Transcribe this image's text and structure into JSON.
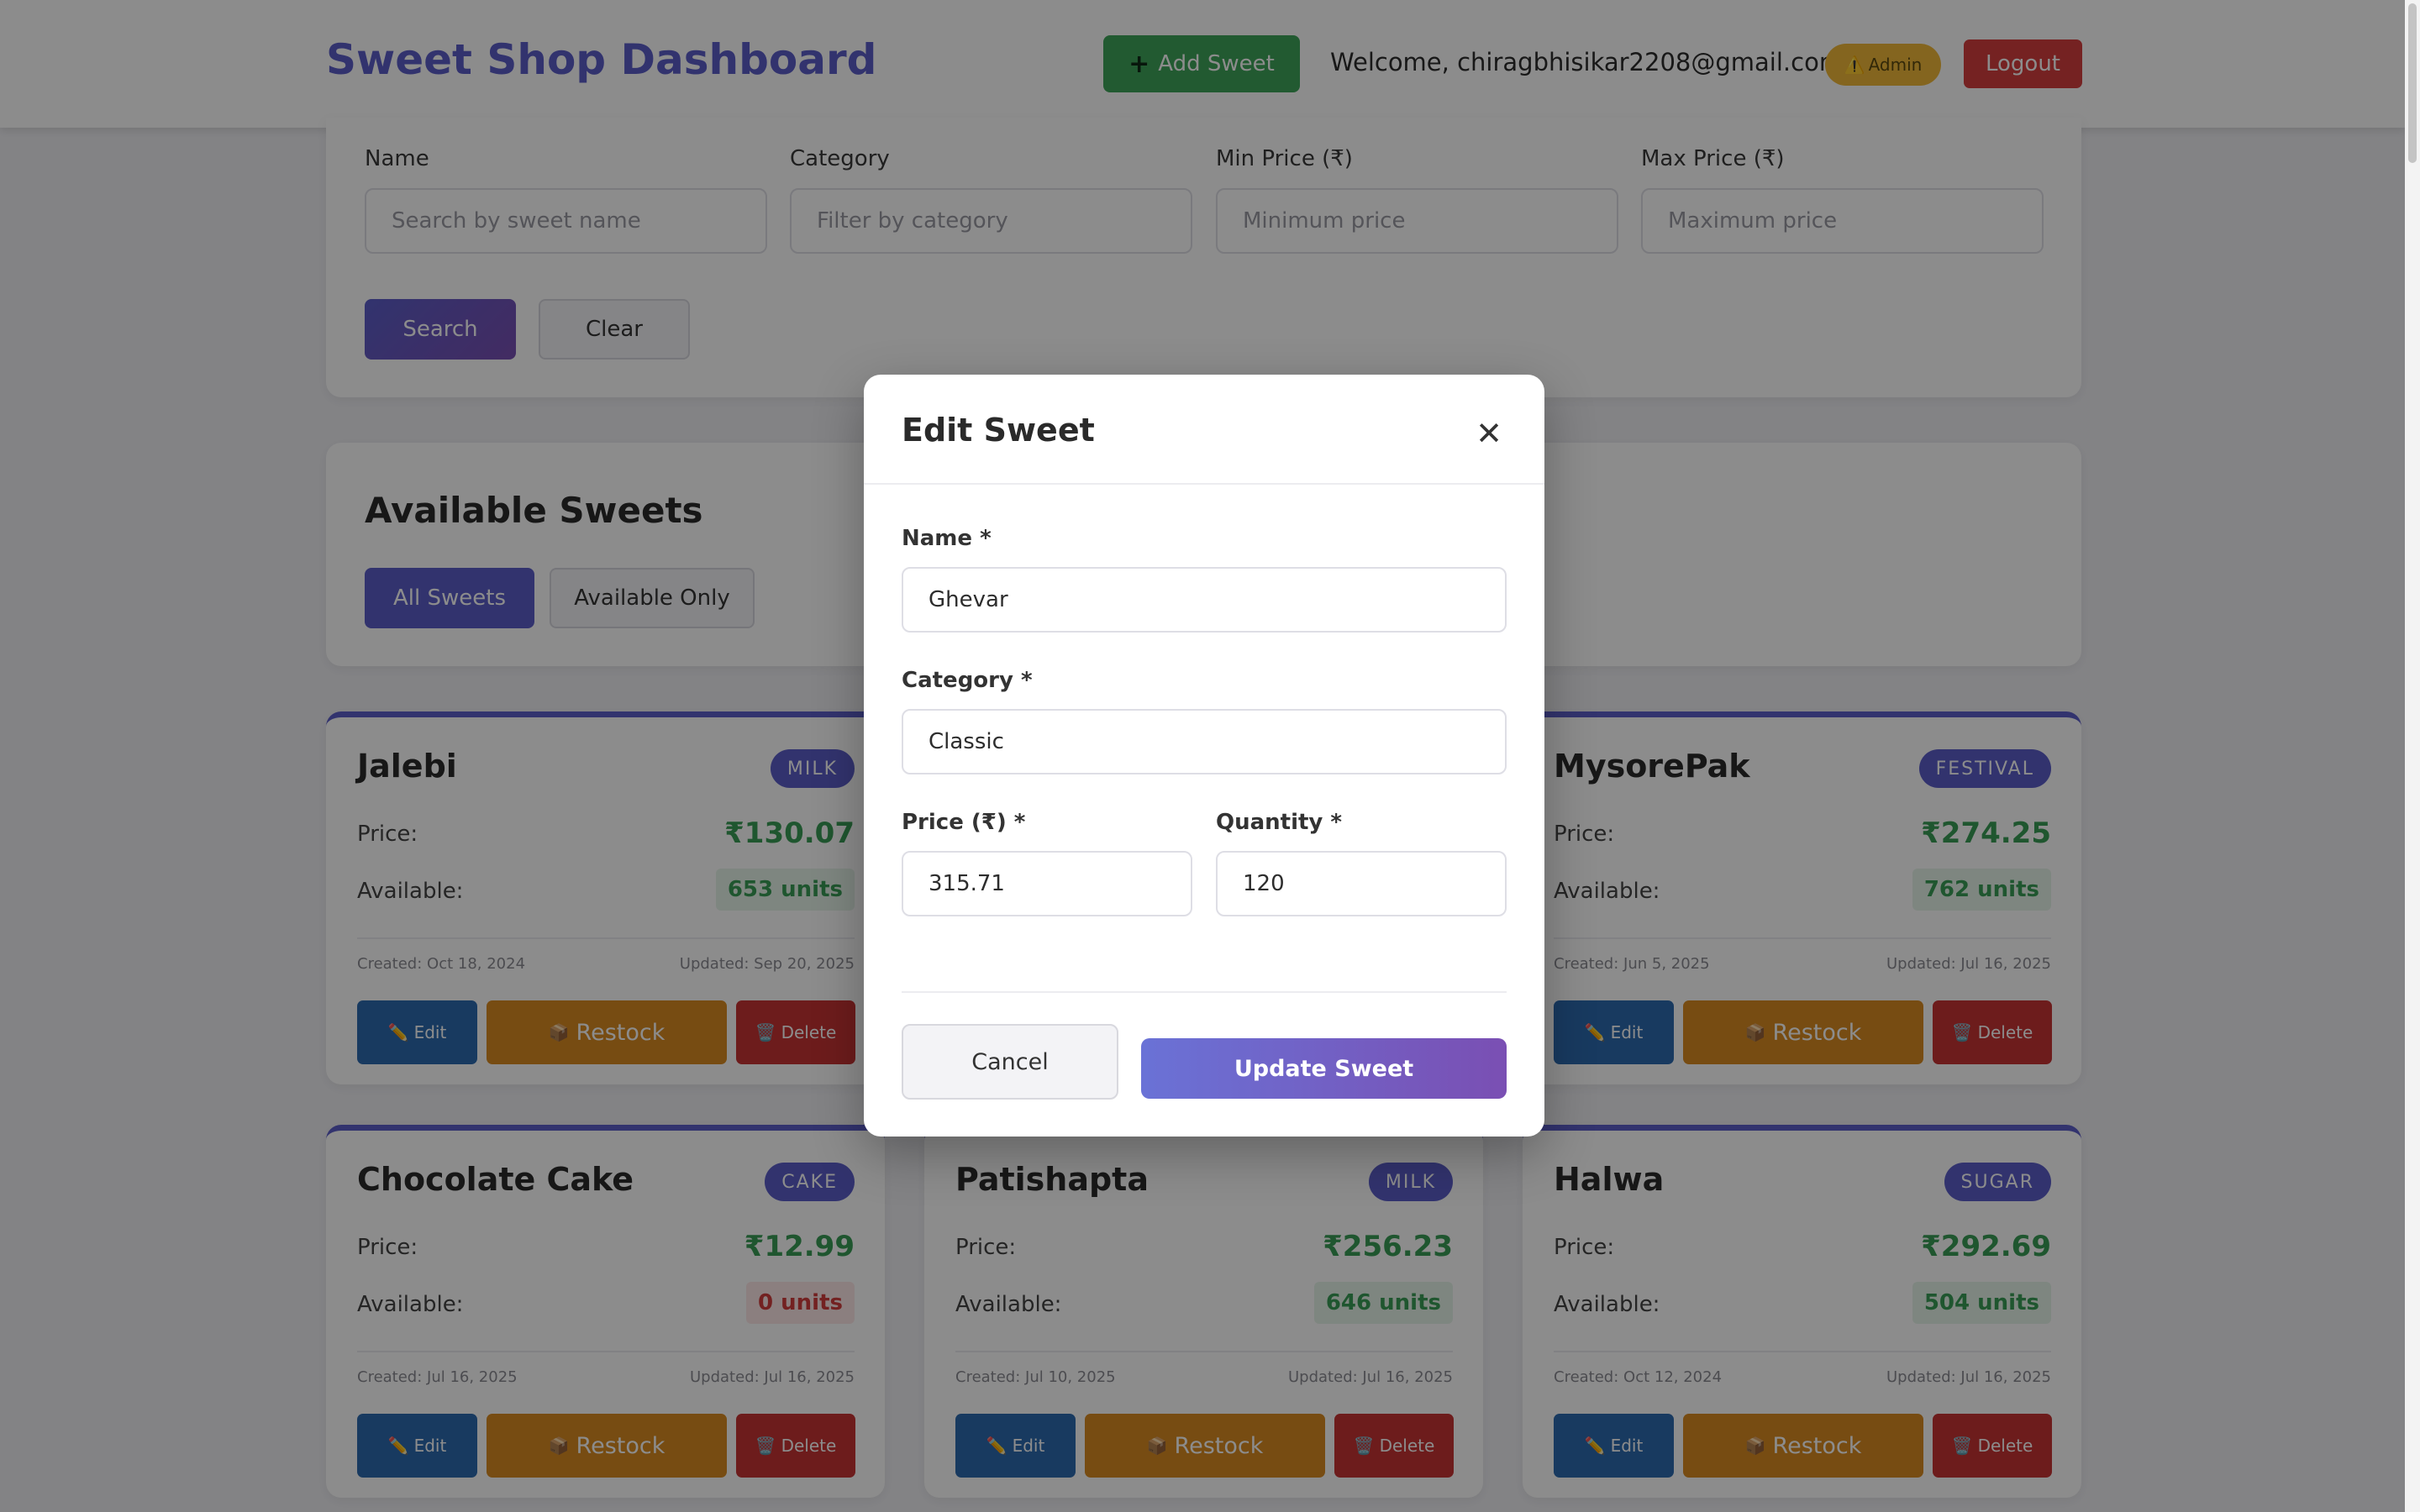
{
  "header": {
    "brand": "Sweet Shop Dashboard",
    "add_button": "Add Sweet",
    "add_icon": "+",
    "welcome": "Welcome, chiragbhisikar2208@gmail.com",
    "admin_badge": "Admin",
    "admin_icon": "⚠️",
    "logout": "Logout"
  },
  "filters": {
    "name_label": "Name",
    "name_placeholder": "Search by sweet name",
    "category_label": "Category",
    "category_placeholder": "Filter by category",
    "min_label": "Min Price (₹)",
    "min_placeholder": "Minimum price",
    "max_label": "Max Price (₹)",
    "max_placeholder": "Maximum price",
    "search_button": "Search",
    "clear_button": "Clear"
  },
  "sweets_section": {
    "title": "Available Sweets",
    "tab_all": "All Sweets",
    "tab_available": "Available Only"
  },
  "card_labels": {
    "price": "Price:",
    "available": "Available:",
    "edit": "Edit",
    "edit_icon": "✏️",
    "restock": "Restock",
    "restock_icon": "📦",
    "delete": "Delete",
    "delete_icon": "🗑️"
  },
  "cards": [
    {
      "name": "Jalebi",
      "category": "MILK",
      "price": "₹130.07",
      "units": "653 units",
      "created": "Created: Oct 18, 2024",
      "updated": "Updated: Sep 20, 2025"
    },
    {
      "name": "MysorePak",
      "category": "FESTIVAL",
      "price": "₹274.25",
      "units": "762 units",
      "created": "Created: Jun 5, 2025",
      "updated": "Updated: Jul 16, 2025"
    },
    {
      "name": "Chocolate Cake",
      "category": "CAKE",
      "price": "₹12.99",
      "units": "0 units",
      "created": "Created: Jul 16, 2025",
      "updated": "Updated: Jul 16, 2025"
    },
    {
      "name": "Patishapta",
      "category": "MILK",
      "price": "₹256.23",
      "units": "646 units",
      "created": "Created: Jul 10, 2025",
      "updated": "Updated: Jul 16, 2025"
    },
    {
      "name": "Halwa",
      "category": "SUGAR",
      "price": "₹292.69",
      "units": "504 units",
      "created": "Created: Oct 12, 2024",
      "updated": "Updated: Jul 16, 2025"
    }
  ],
  "modal": {
    "title": "Edit Sweet",
    "close_icon": "✕",
    "name_label": "Name *",
    "name_value": "Ghevar",
    "category_label": "Category *",
    "category_value": "Classic",
    "price_label": "Price (₹) *",
    "price_value": "315.71",
    "quantity_label": "Quantity *",
    "quantity_value": "120",
    "cancel": "Cancel",
    "update": "Update Sweet"
  },
  "colors": {
    "brand": "#5b5ec9",
    "success": "#3fa45a",
    "danger": "#d63e3e",
    "warning": "#d98b22",
    "info": "#2d6bb0"
  }
}
